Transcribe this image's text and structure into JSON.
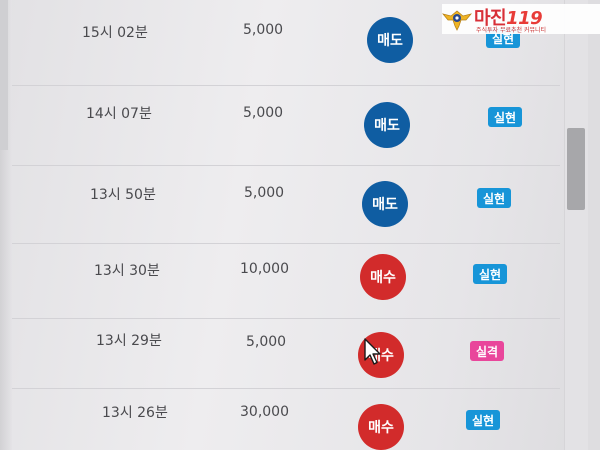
{
  "logo": {
    "text": "마진",
    "accent": "119",
    "subtitle": "주식투자 무료추천 커뮤니티"
  },
  "rows": [
    {
      "time": "15시 02분",
      "amount": "5,000",
      "type": "매도",
      "kind": "sell",
      "status": "실현",
      "status_color": "blue"
    },
    {
      "time": "14시 07분",
      "amount": "5,000",
      "type": "매도",
      "kind": "sell",
      "status": "실현",
      "status_color": "blue"
    },
    {
      "time": "13시 50분",
      "amount": "5,000",
      "type": "매도",
      "kind": "sell",
      "status": "실현",
      "status_color": "blue"
    },
    {
      "time": "13시 30분",
      "amount": "10,000",
      "type": "매수",
      "kind": "buy",
      "status": "실현",
      "status_color": "blue"
    },
    {
      "time": "13시 29분",
      "amount": "5,000",
      "type": "매수",
      "kind": "buy",
      "status": "실격",
      "status_color": "pink"
    },
    {
      "time": "13시 26분",
      "amount": "30,000",
      "type": "매수",
      "kind": "buy",
      "status": "실현",
      "status_color": "blue"
    }
  ],
  "colors": {
    "sell": "#0f5da2",
    "buy": "#d22b2b",
    "status_blue": "#1795d8",
    "status_pink": "#e9469b"
  }
}
